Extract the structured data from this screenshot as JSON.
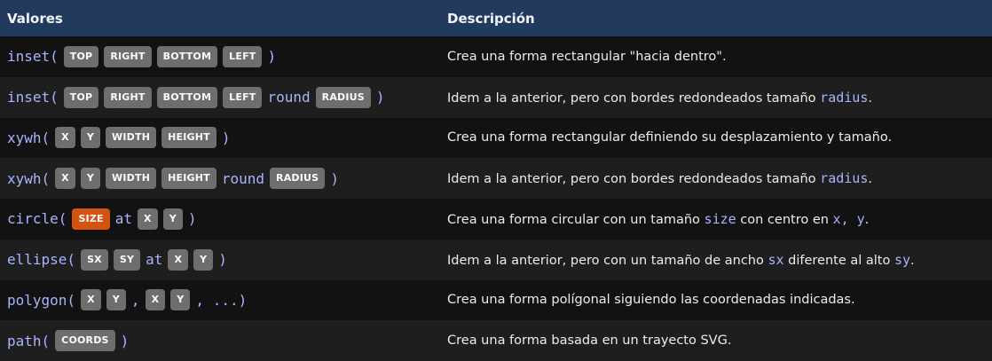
{
  "header": {
    "col1": "Valores",
    "col2": "Descripción"
  },
  "colors": {
    "header_bg": "#233a5f",
    "chip_gray": "#6e6e6e",
    "chip_orange": "#d35410",
    "code": "#a8b4ff"
  },
  "rows": [
    {
      "value": [
        {
          "t": "code",
          "v": "inset("
        },
        {
          "t": "chip",
          "v": "TOP"
        },
        {
          "t": "chip",
          "v": "RIGHT"
        },
        {
          "t": "chip",
          "v": "BOTTOM"
        },
        {
          "t": "chip",
          "v": "LEFT"
        },
        {
          "t": "code",
          "v": ")"
        }
      ],
      "desc": [
        {
          "t": "text",
          "v": "Crea una forma rectangular \"hacia dentro\"."
        }
      ]
    },
    {
      "value": [
        {
          "t": "code",
          "v": "inset("
        },
        {
          "t": "chip",
          "v": "TOP"
        },
        {
          "t": "chip",
          "v": "RIGHT"
        },
        {
          "t": "chip",
          "v": "BOTTOM"
        },
        {
          "t": "chip",
          "v": "LEFT"
        },
        {
          "t": "code",
          "v": "round"
        },
        {
          "t": "chip",
          "v": "RADIUS"
        },
        {
          "t": "code",
          "v": ")"
        }
      ],
      "desc": [
        {
          "t": "text",
          "v": "Idem a la anterior, pero con bordes redondeados tamaño "
        },
        {
          "t": "code",
          "v": "radius"
        },
        {
          "t": "text",
          "v": "."
        }
      ]
    },
    {
      "value": [
        {
          "t": "code",
          "v": "xywh("
        },
        {
          "t": "chip",
          "v": "X"
        },
        {
          "t": "chip",
          "v": "Y"
        },
        {
          "t": "chip",
          "v": "WIDTH"
        },
        {
          "t": "chip",
          "v": "HEIGHT"
        },
        {
          "t": "code",
          "v": ")"
        }
      ],
      "desc": [
        {
          "t": "text",
          "v": "Crea una forma rectangular definiendo su desplazamiento y tamaño."
        }
      ]
    },
    {
      "value": [
        {
          "t": "code",
          "v": "xywh("
        },
        {
          "t": "chip",
          "v": "X"
        },
        {
          "t": "chip",
          "v": "Y"
        },
        {
          "t": "chip",
          "v": "WIDTH"
        },
        {
          "t": "chip",
          "v": "HEIGHT"
        },
        {
          "t": "code",
          "v": "round"
        },
        {
          "t": "chip",
          "v": "RADIUS"
        },
        {
          "t": "code",
          "v": ")"
        }
      ],
      "desc": [
        {
          "t": "text",
          "v": "Idem a la anterior, pero con bordes redondeados tamaño "
        },
        {
          "t": "code",
          "v": "radius"
        },
        {
          "t": "text",
          "v": "."
        }
      ]
    },
    {
      "value": [
        {
          "t": "code",
          "v": "circle("
        },
        {
          "t": "chip-orange",
          "v": "SIZE"
        },
        {
          "t": "code",
          "v": "at"
        },
        {
          "t": "chip",
          "v": "X"
        },
        {
          "t": "chip",
          "v": "Y"
        },
        {
          "t": "code",
          "v": ")"
        }
      ],
      "desc": [
        {
          "t": "text",
          "v": "Crea una forma circular con un tamaño "
        },
        {
          "t": "code",
          "v": "size"
        },
        {
          "t": "text",
          "v": " con centro en "
        },
        {
          "t": "code",
          "v": "x, y"
        },
        {
          "t": "text",
          "v": "."
        }
      ]
    },
    {
      "value": [
        {
          "t": "code",
          "v": "ellipse("
        },
        {
          "t": "chip",
          "v": "SX"
        },
        {
          "t": "chip",
          "v": "SY"
        },
        {
          "t": "code",
          "v": "at"
        },
        {
          "t": "chip",
          "v": "X"
        },
        {
          "t": "chip",
          "v": "Y"
        },
        {
          "t": "code",
          "v": ")"
        }
      ],
      "desc": [
        {
          "t": "text",
          "v": "Idem a la anterior, pero con un tamaño de ancho "
        },
        {
          "t": "code",
          "v": "sx"
        },
        {
          "t": "text",
          "v": " diferente al alto "
        },
        {
          "t": "code",
          "v": "sy"
        },
        {
          "t": "text",
          "v": "."
        }
      ]
    },
    {
      "value": [
        {
          "t": "code",
          "v": "polygon("
        },
        {
          "t": "chip",
          "v": "X"
        },
        {
          "t": "chip",
          "v": "Y"
        },
        {
          "t": "code",
          "v": ","
        },
        {
          "t": "chip",
          "v": "X"
        },
        {
          "t": "chip",
          "v": "Y"
        },
        {
          "t": "code",
          "v": ", ...)"
        }
      ],
      "desc": [
        {
          "t": "text",
          "v": "Crea una forma polígonal siguiendo las coordenadas indicadas."
        }
      ]
    },
    {
      "value": [
        {
          "t": "code",
          "v": "path("
        },
        {
          "t": "chip",
          "v": "COORDS"
        },
        {
          "t": "code",
          "v": ")"
        }
      ],
      "desc": [
        {
          "t": "text",
          "v": "Crea una forma basada en un trayecto SVG."
        }
      ]
    }
  ]
}
